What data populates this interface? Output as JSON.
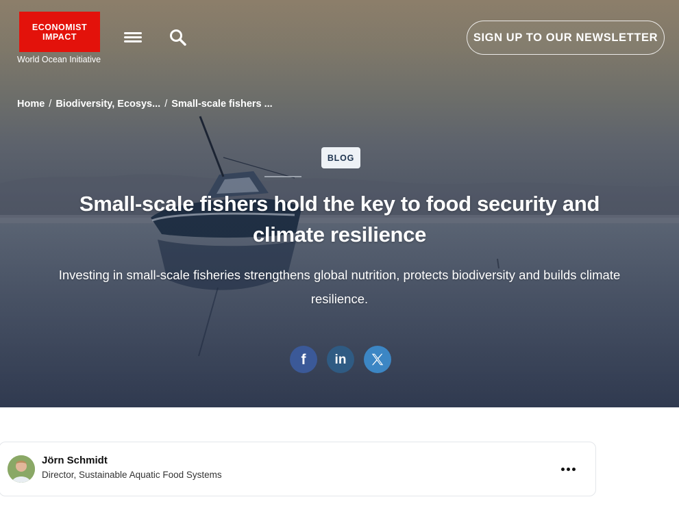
{
  "header": {
    "logo_line1": "ECONOMIST",
    "logo_line2": "IMPACT",
    "logo_subtitle": "World Ocean Initiative",
    "menu_icon": "hamburger-menu-icon",
    "search_icon": "search-icon",
    "newsletter_label": "SIGN UP TO OUR NEWSLETTER"
  },
  "breadcrumb": {
    "items": [
      "Home",
      "Biodiversity, Ecosys...",
      "Small-scale fishers ..."
    ],
    "separator": "/"
  },
  "article": {
    "badge": "BLOG",
    "title": "Small-scale fishers hold the key to food security and climate resilience",
    "subtitle": "Investing in small-scale fisheries strengthens global nutrition, protects biodiversity and builds climate resilience."
  },
  "share": {
    "facebook_glyph": "f",
    "linkedin_glyph": "in",
    "x_icon": "x-logo-icon"
  },
  "author": {
    "name": "Jörn Schmidt",
    "role": "Director, Sustainable Aquatic Food Systems",
    "more_icon": "more-options-icon"
  },
  "colors": {
    "brand_red": "#e3120b",
    "facebook": "#3b5998",
    "linkedin": "#2f5b83",
    "x": "#3c86c4",
    "badge_bg": "#eef2f6"
  }
}
